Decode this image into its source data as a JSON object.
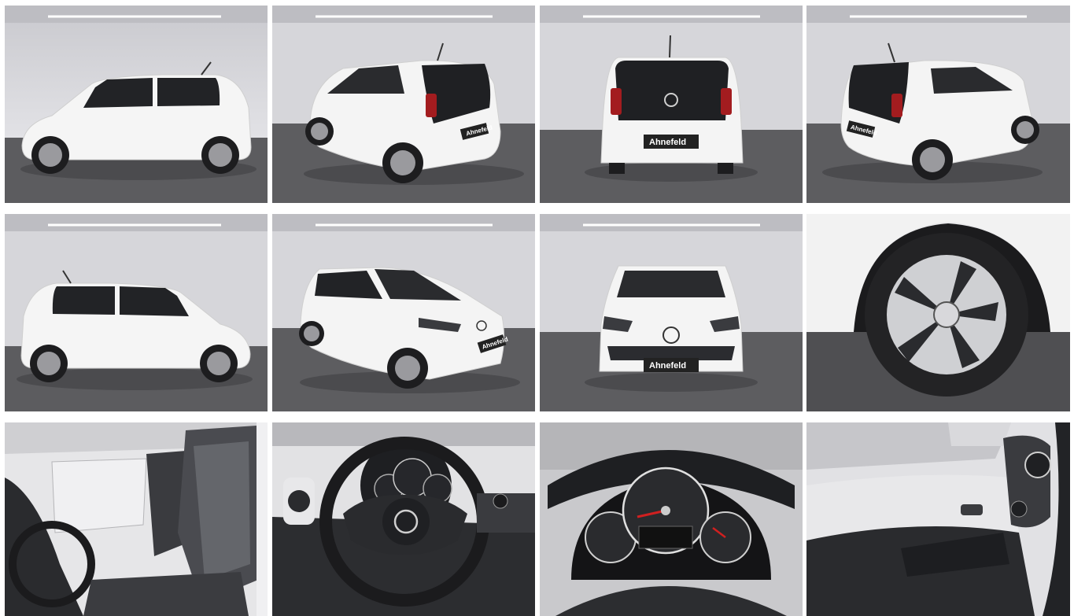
{
  "gallery": {
    "dealer_plate": "Ahnefeld",
    "photos": [
      {
        "id": "side-left",
        "description_tag": "exterior-side-left"
      },
      {
        "id": "rear-three-quarter-left",
        "description_tag": "exterior-rear-left"
      },
      {
        "id": "rear",
        "description_tag": "exterior-rear"
      },
      {
        "id": "rear-three-quarter-right",
        "description_tag": "exterior-rear-right"
      },
      {
        "id": "side-right",
        "description_tag": "exterior-side-right"
      },
      {
        "id": "front-three-quarter-right",
        "description_tag": "exterior-front-right"
      },
      {
        "id": "front",
        "description_tag": "exterior-front"
      },
      {
        "id": "wheel",
        "description_tag": "wheel-detail"
      },
      {
        "id": "front-seats",
        "description_tag": "interior-seats"
      },
      {
        "id": "steering-wheel",
        "description_tag": "interior-steering-wheel"
      },
      {
        "id": "instrument-cluster",
        "description_tag": "interior-cluster"
      },
      {
        "id": "door-panel",
        "description_tag": "interior-door"
      }
    ]
  },
  "colors": {
    "studio_wall": "#d8d8dc",
    "studio_floor": "#5e5e60",
    "car_body": "#f4f4f4",
    "glass": "#1e1f22",
    "tail_light": "#a31c1f",
    "interior_dark": "#2a2b2e",
    "interior_grey": "#7d7f84"
  }
}
